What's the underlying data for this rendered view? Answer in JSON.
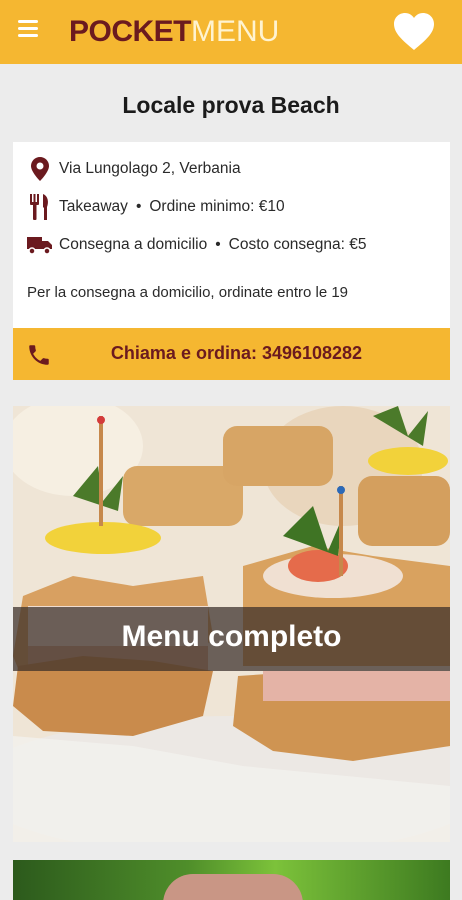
{
  "header": {
    "logo_bold": "POCKET",
    "logo_light": "MENU",
    "menu_icon": "hamburger-icon",
    "favorite_icon": "heart-icon",
    "brand_color": "#f5b731",
    "accent_color": "#6b1a1f"
  },
  "venue": {
    "name": "Locale prova Beach",
    "address": "Via Lungolago 2, Verbania",
    "takeaway": "Takeaway",
    "min_order": "Ordine minimo: €10",
    "delivery": "Consegna a domicilio",
    "delivery_cost": "Costo consegna: €5",
    "separator": "•",
    "note": "Per la consegna a domicilio, ordinate entro le 19"
  },
  "call": {
    "label": "Chiama e ordina: 3496108282",
    "icon": "phone-icon"
  },
  "menu_card": {
    "label": "Menu completo"
  }
}
